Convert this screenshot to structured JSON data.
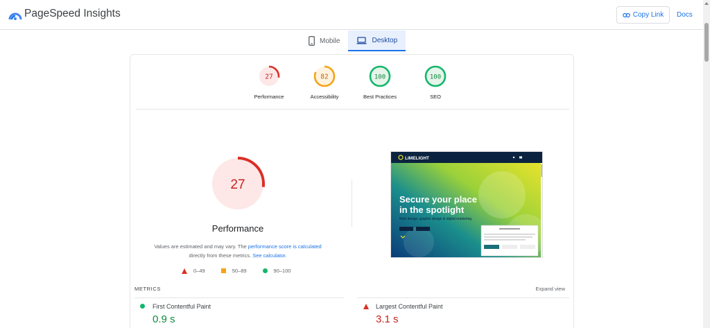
{
  "header": {
    "title": "PageSpeed Insights",
    "copy_link_label": "Copy Link",
    "docs_label": "Docs"
  },
  "tabs": [
    {
      "label": "Mobile",
      "icon": "phone-icon",
      "active": false
    },
    {
      "label": "Desktop",
      "icon": "laptop-icon",
      "active": true
    }
  ],
  "categories": [
    {
      "label": "Performance",
      "score": "27",
      "fraction": 0.27,
      "status": "fail"
    },
    {
      "label": "Accessibility",
      "score": "82",
      "fraction": 0.82,
      "status": "average"
    },
    {
      "label": "Best Practices",
      "score": "100",
      "fraction": 1.0,
      "status": "pass"
    },
    {
      "label": "SEO",
      "score": "100",
      "fraction": 1.0,
      "status": "pass"
    }
  ],
  "performance": {
    "score": "27",
    "fraction": 0.27,
    "title": "Performance",
    "desc_prefix": "Values are estimated and may vary. The ",
    "desc_link1": "performance score is calculated",
    "desc_middle": " directly from these metrics. ",
    "desc_link2": "See calculator."
  },
  "legend": [
    {
      "shape": "triangle",
      "range": "0–49"
    },
    {
      "shape": "square",
      "range": "50–89"
    },
    {
      "shape": "circle",
      "range": "90–100"
    }
  ],
  "screenshot": {
    "brand": "LIMELIGHT",
    "headline_line1": "Secure your place",
    "headline_line2": "in the spotlight",
    "subtitle": "Web design, graphic design & digital marketing"
  },
  "metrics": {
    "header": "METRICS",
    "expand_label": "Expand view",
    "items": [
      {
        "name": "First Contentful Paint",
        "value": "0.9 s",
        "status": "pass"
      },
      {
        "name": "Largest Contentful Paint",
        "value": "3.1 s",
        "status": "fail"
      }
    ]
  },
  "colors": {
    "fail": "#d93025",
    "fail_bg": "#fde7e7",
    "average": "#f4a416",
    "average_bg": "#fff3e0",
    "pass": "#12b76a",
    "pass_bg": "#e6f4ea",
    "link": "#1a73e8"
  }
}
